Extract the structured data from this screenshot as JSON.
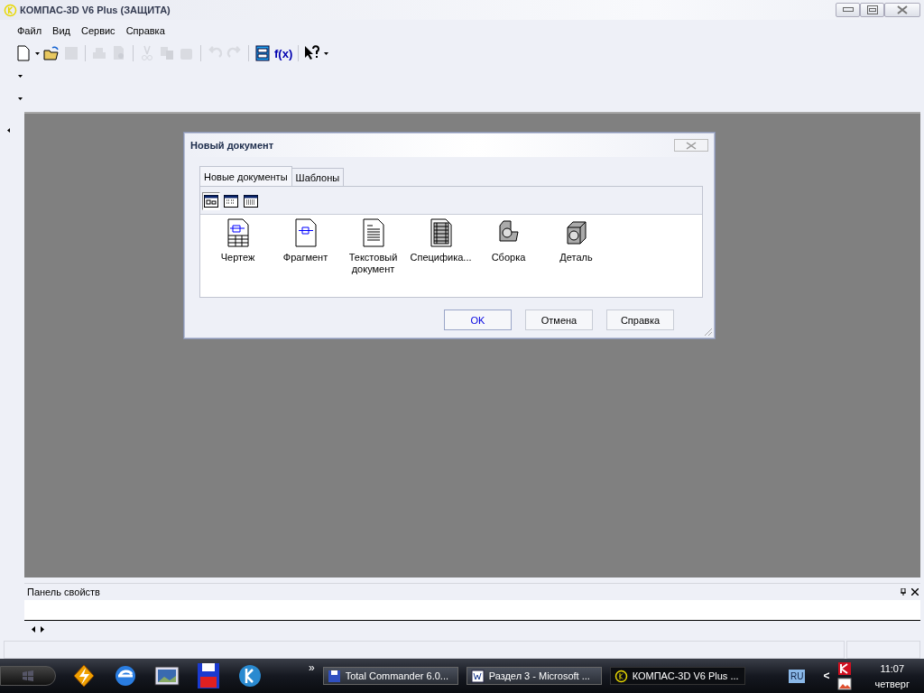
{
  "window": {
    "title": "КОМПАС-3D V6 Plus (ЗАЩИТА)"
  },
  "menu": [
    {
      "label": "Файл"
    },
    {
      "label": "Вид"
    },
    {
      "label": "Сервис"
    },
    {
      "label": "Справка"
    }
  ],
  "toolbar": [
    {
      "kind": "new",
      "disabled": false
    },
    {
      "kind": "dropdown"
    },
    {
      "kind": "open",
      "disabled": false
    },
    {
      "kind": "save",
      "disabled": true
    },
    {
      "kind": "sep"
    },
    {
      "kind": "print",
      "disabled": true
    },
    {
      "kind": "preview",
      "disabled": true
    },
    {
      "kind": "sep"
    },
    {
      "kind": "cut",
      "disabled": true
    },
    {
      "kind": "copy",
      "disabled": true
    },
    {
      "kind": "paste",
      "disabled": true
    },
    {
      "kind": "sep"
    },
    {
      "kind": "undo",
      "disabled": true
    },
    {
      "kind": "redo",
      "disabled": true
    },
    {
      "kind": "sep"
    },
    {
      "kind": "variables",
      "disabled": false
    },
    {
      "kind": "fx",
      "disabled": false,
      "label": "f(x)"
    },
    {
      "kind": "sep"
    },
    {
      "kind": "help",
      "disabled": false
    },
    {
      "kind": "dropdown"
    }
  ],
  "dialog": {
    "title": "Новый документ",
    "tabs": [
      {
        "label": "Новые документы",
        "selected": true
      },
      {
        "label": "Шаблоны",
        "selected": false
      }
    ],
    "view_buttons": [
      {
        "kind": "large",
        "selected": true
      },
      {
        "kind": "list",
        "selected": false
      },
      {
        "kind": "details",
        "selected": false
      }
    ],
    "documents": [
      {
        "kind": "drawing",
        "label": "Чертеж"
      },
      {
        "kind": "fragment",
        "label": "Фрагмент"
      },
      {
        "kind": "text",
        "label": "Текстовый документ"
      },
      {
        "kind": "spec",
        "label": "Специфика..."
      },
      {
        "kind": "assembly",
        "label": "Сборка"
      },
      {
        "kind": "part",
        "label": "Деталь"
      }
    ],
    "buttons": [
      {
        "label": "OK",
        "default": true
      },
      {
        "label": "Отмена",
        "default": false
      },
      {
        "label": "Справка",
        "default": false
      }
    ]
  },
  "properties_panel": {
    "title": "Панель свойств"
  },
  "taskbar": {
    "quick_launch": [
      {
        "kind": "lightning"
      },
      {
        "kind": "ie"
      },
      {
        "kind": "picture"
      },
      {
        "kind": "floppy"
      },
      {
        "kind": "kompas"
      }
    ],
    "more": "»",
    "tasks": [
      {
        "kind": "floppy",
        "label": "Total Commander 6.0...",
        "selected": false
      },
      {
        "kind": "word",
        "label": "Раздел 3 - Microsoft ...",
        "selected": false
      },
      {
        "kind": "kompas",
        "label": "КОМПАС-3D V6 Plus ...",
        "selected": true
      }
    ],
    "language": "RU",
    "tray_toggle": "<",
    "time": "11:07",
    "day": "четверг"
  }
}
